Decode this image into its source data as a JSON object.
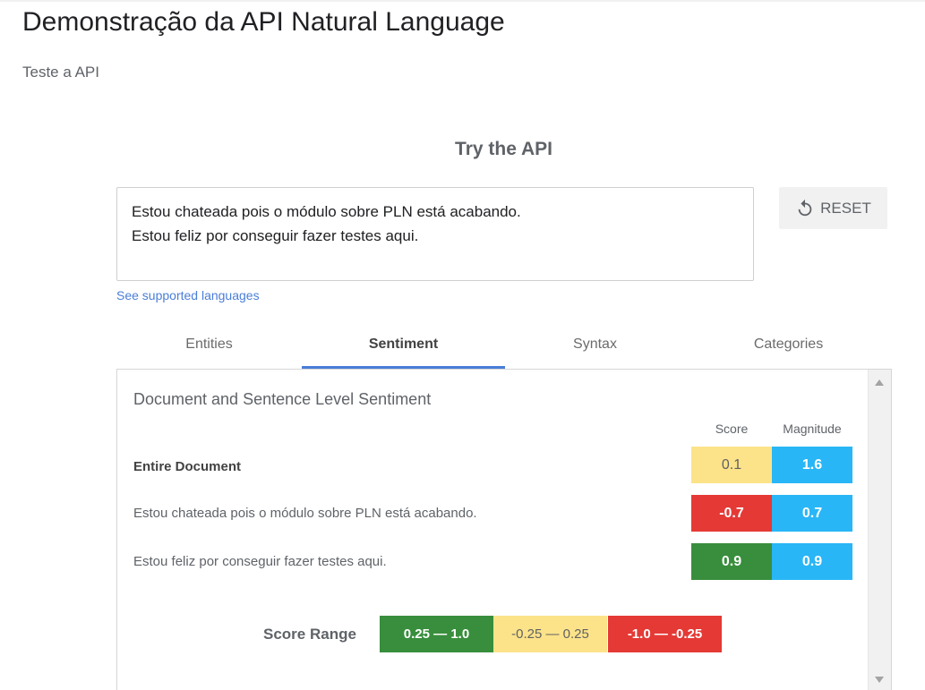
{
  "page": {
    "title": "Demonstração da API Natural Language",
    "subtitle": "Teste a API"
  },
  "try_api": {
    "title": "Try the API",
    "input_lines": [
      "Estou chateada pois o módulo sobre PLN está acabando.",
      "Estou feliz por conseguir fazer testes aqui."
    ],
    "reset_label": "RESET",
    "languages_link": "See supported languages"
  },
  "tabs": [
    {
      "label": "Entities",
      "active": false
    },
    {
      "label": "Sentiment",
      "active": true
    },
    {
      "label": "Syntax",
      "active": false
    },
    {
      "label": "Categories",
      "active": false
    }
  ],
  "sentiment": {
    "section_title": "Document and Sentence Level Sentiment",
    "score_header": "Score",
    "magnitude_header": "Magnitude",
    "rows": [
      {
        "label": "Entire Document",
        "score": "0.1",
        "magnitude": "1.6",
        "score_color": "#fce38a",
        "magnitude_color": "#29b6f6"
      },
      {
        "label": "Estou chateada pois o módulo sobre PLN está acabando.",
        "score": "-0.7",
        "magnitude": "0.7",
        "score_color": "#e53935",
        "magnitude_color": "#29b6f6"
      },
      {
        "label": "Estou feliz por conseguir fazer testes aqui.",
        "score": "0.9",
        "magnitude": "0.9",
        "score_color": "#388e3c",
        "magnitude_color": "#29b6f6"
      }
    ],
    "score_range": {
      "label": "Score Range",
      "positive": "0.25 — 1.0",
      "neutral": "-0.25 — 0.25",
      "negative": "-1.0 — -0.25"
    }
  },
  "colors": {
    "accent": "#4a7ed8",
    "positive": "#388e3c",
    "neutral": "#fce38a",
    "negative": "#e53935",
    "magnitude": "#29b6f6"
  },
  "icons": {
    "reset": "reset-icon",
    "scroll_up": "arrow-up-icon",
    "scroll_down": "arrow-down-icon"
  }
}
